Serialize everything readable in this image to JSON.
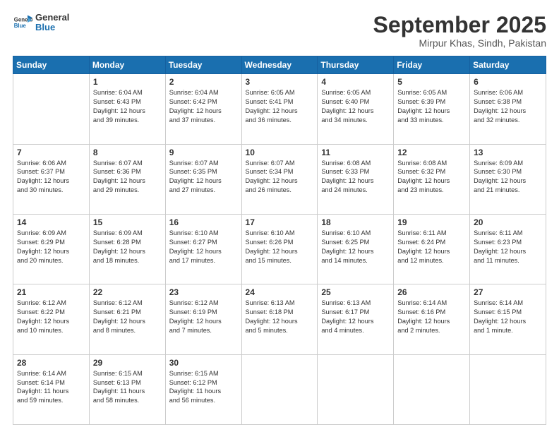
{
  "logo": {
    "line1": "General",
    "line2": "Blue"
  },
  "title": "September 2025",
  "location": "Mirpur Khas, Sindh, Pakistan",
  "days_header": [
    "Sunday",
    "Monday",
    "Tuesday",
    "Wednesday",
    "Thursday",
    "Friday",
    "Saturday"
  ],
  "weeks": [
    [
      {
        "day": "",
        "info": ""
      },
      {
        "day": "1",
        "info": "Sunrise: 6:04 AM\nSunset: 6:43 PM\nDaylight: 12 hours\nand 39 minutes."
      },
      {
        "day": "2",
        "info": "Sunrise: 6:04 AM\nSunset: 6:42 PM\nDaylight: 12 hours\nand 37 minutes."
      },
      {
        "day": "3",
        "info": "Sunrise: 6:05 AM\nSunset: 6:41 PM\nDaylight: 12 hours\nand 36 minutes."
      },
      {
        "day": "4",
        "info": "Sunrise: 6:05 AM\nSunset: 6:40 PM\nDaylight: 12 hours\nand 34 minutes."
      },
      {
        "day": "5",
        "info": "Sunrise: 6:05 AM\nSunset: 6:39 PM\nDaylight: 12 hours\nand 33 minutes."
      },
      {
        "day": "6",
        "info": "Sunrise: 6:06 AM\nSunset: 6:38 PM\nDaylight: 12 hours\nand 32 minutes."
      }
    ],
    [
      {
        "day": "7",
        "info": "Sunrise: 6:06 AM\nSunset: 6:37 PM\nDaylight: 12 hours\nand 30 minutes."
      },
      {
        "day": "8",
        "info": "Sunrise: 6:07 AM\nSunset: 6:36 PM\nDaylight: 12 hours\nand 29 minutes."
      },
      {
        "day": "9",
        "info": "Sunrise: 6:07 AM\nSunset: 6:35 PM\nDaylight: 12 hours\nand 27 minutes."
      },
      {
        "day": "10",
        "info": "Sunrise: 6:07 AM\nSunset: 6:34 PM\nDaylight: 12 hours\nand 26 minutes."
      },
      {
        "day": "11",
        "info": "Sunrise: 6:08 AM\nSunset: 6:33 PM\nDaylight: 12 hours\nand 24 minutes."
      },
      {
        "day": "12",
        "info": "Sunrise: 6:08 AM\nSunset: 6:32 PM\nDaylight: 12 hours\nand 23 minutes."
      },
      {
        "day": "13",
        "info": "Sunrise: 6:09 AM\nSunset: 6:30 PM\nDaylight: 12 hours\nand 21 minutes."
      }
    ],
    [
      {
        "day": "14",
        "info": "Sunrise: 6:09 AM\nSunset: 6:29 PM\nDaylight: 12 hours\nand 20 minutes."
      },
      {
        "day": "15",
        "info": "Sunrise: 6:09 AM\nSunset: 6:28 PM\nDaylight: 12 hours\nand 18 minutes."
      },
      {
        "day": "16",
        "info": "Sunrise: 6:10 AM\nSunset: 6:27 PM\nDaylight: 12 hours\nand 17 minutes."
      },
      {
        "day": "17",
        "info": "Sunrise: 6:10 AM\nSunset: 6:26 PM\nDaylight: 12 hours\nand 15 minutes."
      },
      {
        "day": "18",
        "info": "Sunrise: 6:10 AM\nSunset: 6:25 PM\nDaylight: 12 hours\nand 14 minutes."
      },
      {
        "day": "19",
        "info": "Sunrise: 6:11 AM\nSunset: 6:24 PM\nDaylight: 12 hours\nand 12 minutes."
      },
      {
        "day": "20",
        "info": "Sunrise: 6:11 AM\nSunset: 6:23 PM\nDaylight: 12 hours\nand 11 minutes."
      }
    ],
    [
      {
        "day": "21",
        "info": "Sunrise: 6:12 AM\nSunset: 6:22 PM\nDaylight: 12 hours\nand 10 minutes."
      },
      {
        "day": "22",
        "info": "Sunrise: 6:12 AM\nSunset: 6:21 PM\nDaylight: 12 hours\nand 8 minutes."
      },
      {
        "day": "23",
        "info": "Sunrise: 6:12 AM\nSunset: 6:19 PM\nDaylight: 12 hours\nand 7 minutes."
      },
      {
        "day": "24",
        "info": "Sunrise: 6:13 AM\nSunset: 6:18 PM\nDaylight: 12 hours\nand 5 minutes."
      },
      {
        "day": "25",
        "info": "Sunrise: 6:13 AM\nSunset: 6:17 PM\nDaylight: 12 hours\nand 4 minutes."
      },
      {
        "day": "26",
        "info": "Sunrise: 6:14 AM\nSunset: 6:16 PM\nDaylight: 12 hours\nand 2 minutes."
      },
      {
        "day": "27",
        "info": "Sunrise: 6:14 AM\nSunset: 6:15 PM\nDaylight: 12 hours\nand 1 minute."
      }
    ],
    [
      {
        "day": "28",
        "info": "Sunrise: 6:14 AM\nSunset: 6:14 PM\nDaylight: 11 hours\nand 59 minutes."
      },
      {
        "day": "29",
        "info": "Sunrise: 6:15 AM\nSunset: 6:13 PM\nDaylight: 11 hours\nand 58 minutes."
      },
      {
        "day": "30",
        "info": "Sunrise: 6:15 AM\nSunset: 6:12 PM\nDaylight: 11 hours\nand 56 minutes."
      },
      {
        "day": "",
        "info": ""
      },
      {
        "day": "",
        "info": ""
      },
      {
        "day": "",
        "info": ""
      },
      {
        "day": "",
        "info": ""
      }
    ]
  ]
}
